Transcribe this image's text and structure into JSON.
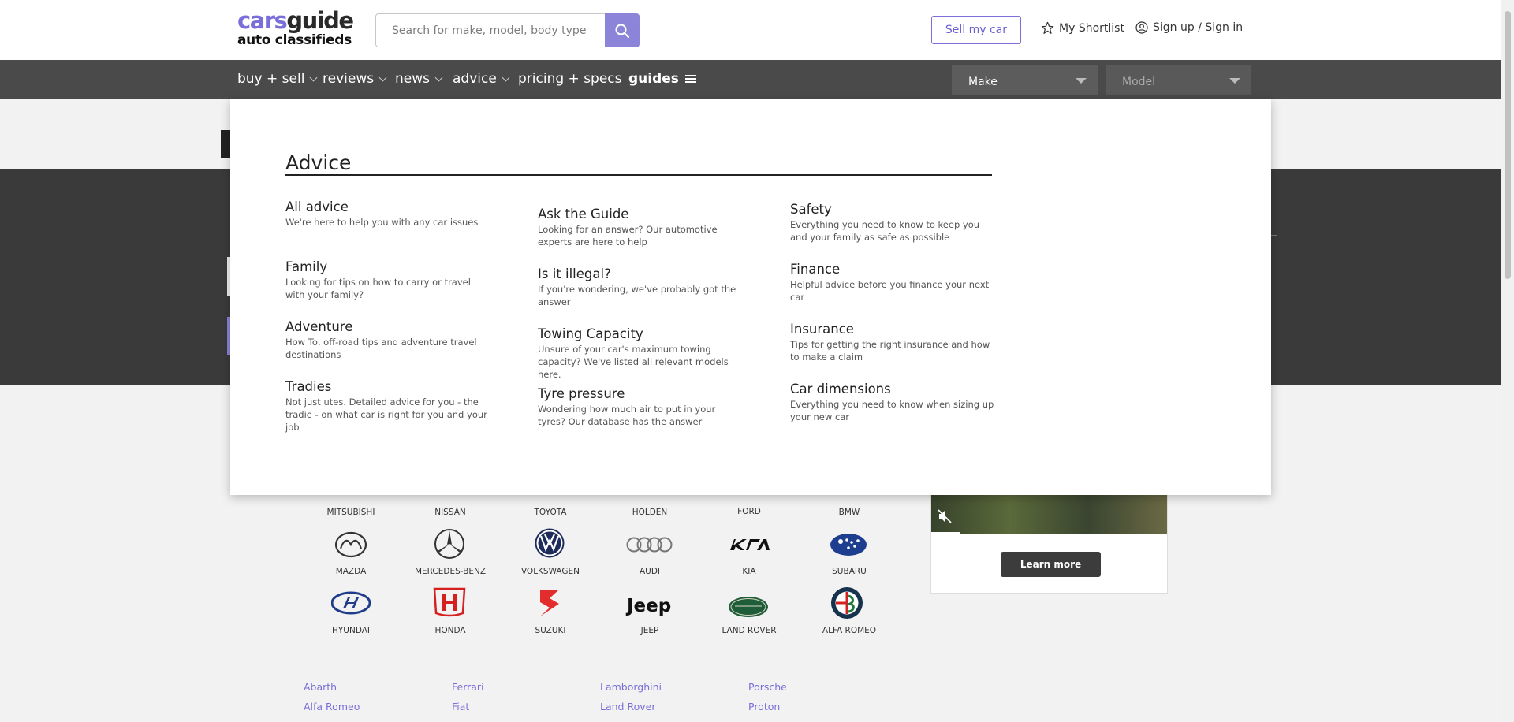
{
  "header": {
    "logo_part1": "cars",
    "logo_part2": "guide",
    "logo_sub": "auto classifieds",
    "search_placeholder": "Search for make, model, body type",
    "sell_label": "Sell my car",
    "shortlist_label": "My Shortlist",
    "signin_label": "Sign up / Sign in"
  },
  "nav": {
    "items": [
      {
        "label": "buy + sell",
        "has_chevron": true
      },
      {
        "label": "reviews",
        "has_chevron": true
      },
      {
        "label": "news",
        "has_chevron": true
      },
      {
        "label": "advice",
        "has_chevron": true
      },
      {
        "label": "pricing + specs",
        "has_chevron": false
      },
      {
        "label": "guides",
        "has_chevron": false
      }
    ],
    "make_label": "Make",
    "model_label": "Model"
  },
  "advice_panel": {
    "title": "Advice",
    "items": [
      {
        "title": "All advice",
        "desc": "We're here to help you with any car issues"
      },
      {
        "title": "Family",
        "desc": "Looking for tips on how to carry or travel with your family?"
      },
      {
        "title": "Adventure",
        "desc": "How To, off-road tips and adventure travel destinations"
      },
      {
        "title": "Tradies",
        "desc": "Not just utes. Detailed advice for you - the tradie - on what car is right for you and your job"
      },
      {
        "title": "Ask the Guide",
        "desc": "Looking for an answer? Our automotive experts are here to help"
      },
      {
        "title": "Is it illegal?",
        "desc": "If you're wondering, we've probably got the answer"
      },
      {
        "title": "Towing Capacity",
        "desc": "Unsure of your car's maximum towing capacity? We've listed all relevant models here."
      },
      {
        "title": "Tyre pressure",
        "desc": "Wondering how much air to put in your tyres? Our database has the answer"
      },
      {
        "title": "Safety",
        "desc": "Everything you need to know to keep you and your family as safe as possible"
      },
      {
        "title": "Finance",
        "desc": "Helpful advice before you finance your next car"
      },
      {
        "title": "Insurance",
        "desc": "Tips for getting the right insurance and how to make a claim"
      },
      {
        "title": "Car dimensions",
        "desc": "Everything you need to know when sizing up your new car"
      }
    ]
  },
  "brands": {
    "row1": [
      "MITSUBISHI",
      "NISSAN",
      "TOYOTA",
      "HOLDEN",
      "FORD",
      "BMW"
    ],
    "row2": [
      "MAZDA",
      "MERCEDES-BENZ",
      "VOLKSWAGEN",
      "AUDI",
      "KIA",
      "SUBARU"
    ],
    "row3": [
      "HYUNDAI",
      "HONDA",
      "SUZUKI",
      "JEEP",
      "LAND ROVER",
      "ALFA ROMEO"
    ]
  },
  "make_links": {
    "col1": [
      "Abarth",
      "Alfa Romeo"
    ],
    "col2": [
      "Ferrari",
      "Fiat"
    ],
    "col3": [
      "Lamborghini",
      "Land Rover"
    ],
    "col4": [
      "Porsche",
      "Proton"
    ]
  },
  "ad": {
    "button_label": "Learn more"
  },
  "colors": {
    "brand_purple": "#7a6fd8",
    "nav_bg": "#4a4a4a"
  }
}
